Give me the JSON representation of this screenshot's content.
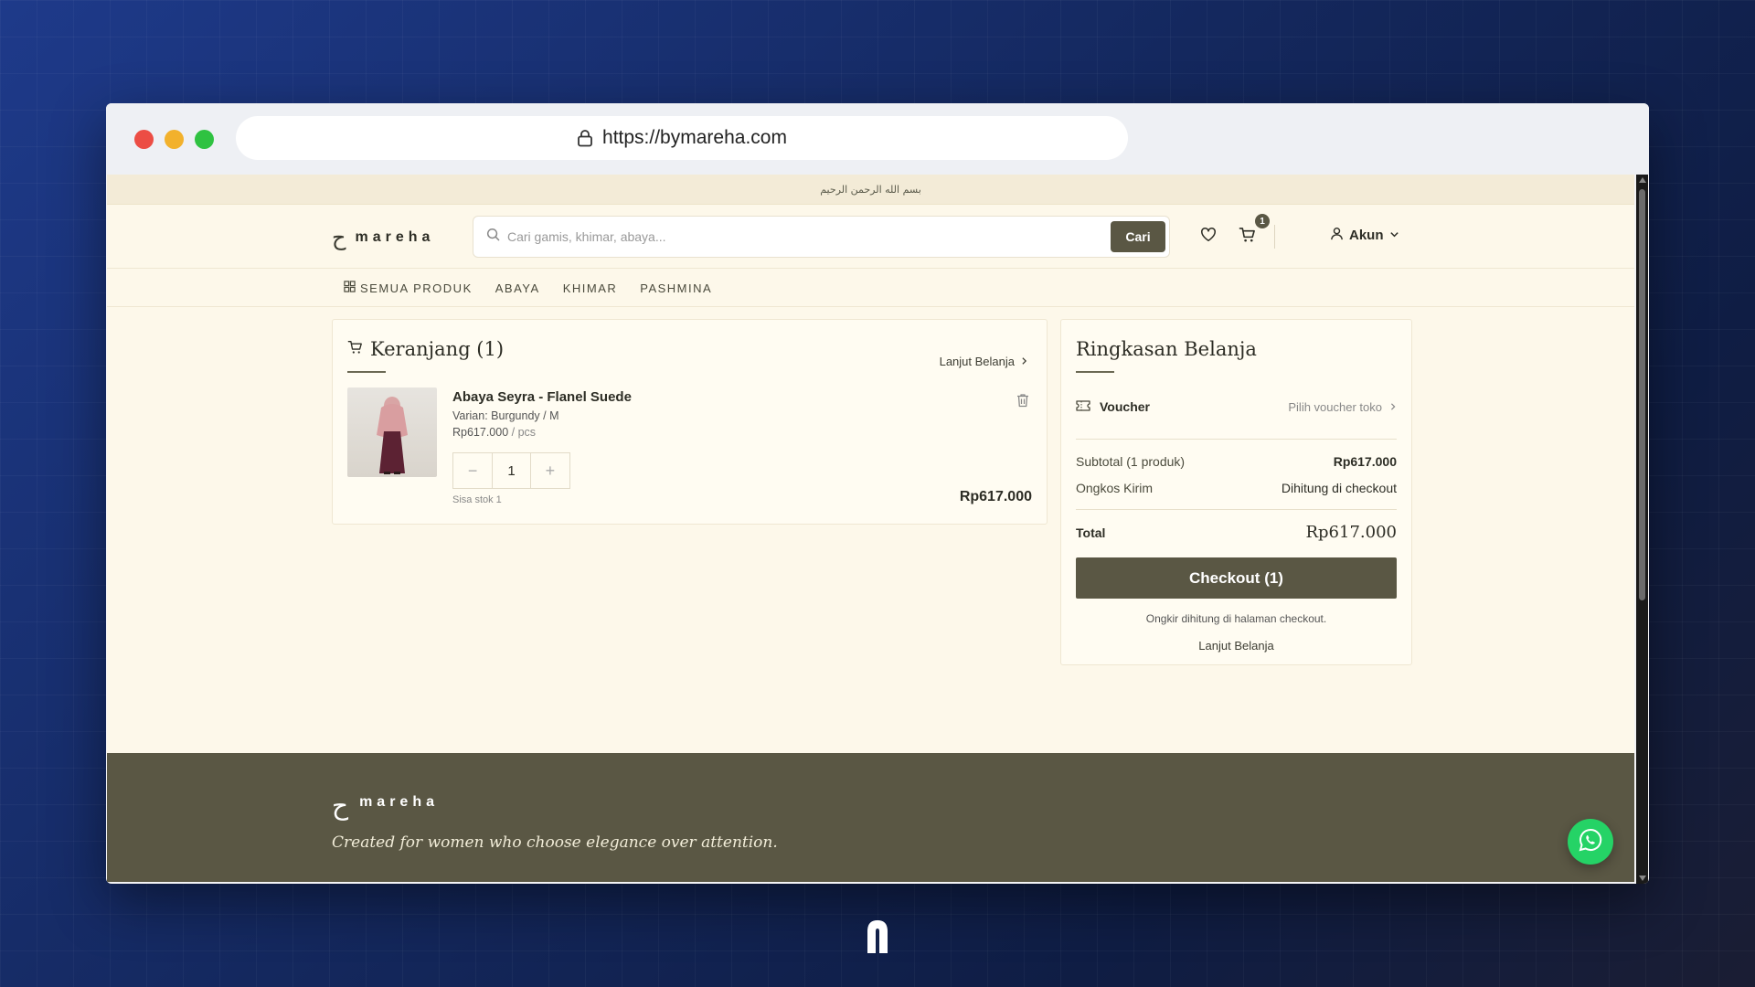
{
  "browser": {
    "url": "https://bymareha.com"
  },
  "banner": {
    "text": "بسم الله الرحمن الرحيم"
  },
  "header": {
    "logo_mark": "ح",
    "logo_word": "mareha",
    "search_placeholder": "Cari gamis, khimar, abaya...",
    "search_button": "Cari",
    "cart_count": "1",
    "account_label": "Akun"
  },
  "nav": {
    "items": [
      "SEMUA PRODUK",
      "ABAYA",
      "KHIMAR",
      "PASHMINA"
    ]
  },
  "cart": {
    "title": "Keranjang (1)",
    "continue_link": "Lanjut Belanja",
    "item": {
      "name": "Abaya Seyra - Flanel Suede",
      "variant": "Varian: Burgundy / M",
      "unit_price": "Rp617.000",
      "unit_suffix": "/ pcs",
      "qty_minus": "−",
      "qty_value": "1",
      "qty_plus": "+",
      "stock": "Sisa stok 1",
      "line_total": "Rp617.000"
    }
  },
  "summary": {
    "title": "Ringkasan Belanja",
    "voucher_label": "Voucher",
    "voucher_action": "Pilih voucher toko",
    "subtotal_label": "Subtotal (1 produk)",
    "subtotal_value": "Rp617.000",
    "shipping_label": "Ongkos Kirim",
    "shipping_value": "Dihitung di checkout",
    "total_label": "Total",
    "total_value": "Rp617.000",
    "checkout_button": "Checkout (1)",
    "note": "Ongkir dihitung di halaman checkout.",
    "continue_link": "Lanjut Belanja"
  },
  "footer": {
    "logo_mark": "ح",
    "logo_word": "mareha",
    "tagline": "Created for women who choose elegance over attention."
  },
  "colors": {
    "brand": "#5a5744",
    "page_bg": "#fdf8ea",
    "whatsapp": "#25d366"
  }
}
